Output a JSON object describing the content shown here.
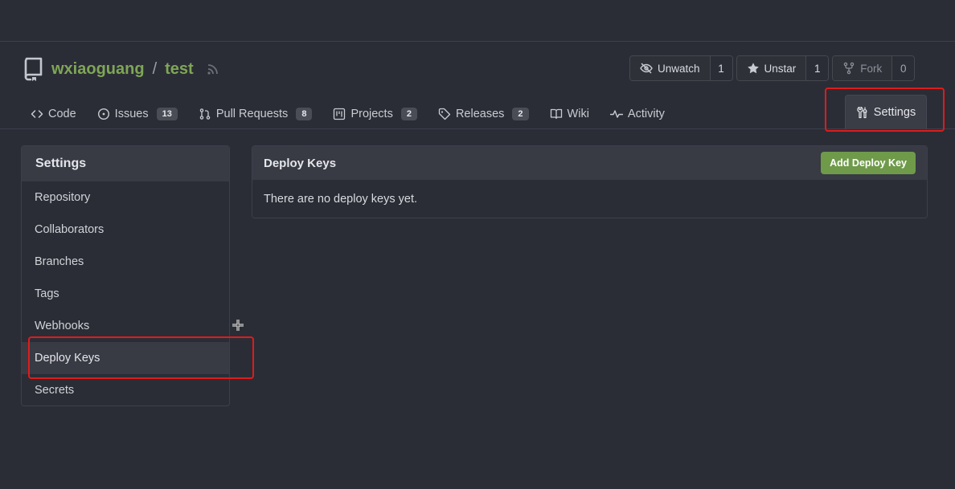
{
  "repo": {
    "owner": "wxiaoguang",
    "separator": "/",
    "name": "test"
  },
  "buttons": {
    "watch": {
      "label": "Unwatch",
      "count": "1"
    },
    "star": {
      "label": "Unstar",
      "count": "1"
    },
    "fork": {
      "label": "Fork",
      "count": "0"
    }
  },
  "tabs": [
    {
      "label": "Code",
      "icon": "code-icon"
    },
    {
      "label": "Issues",
      "icon": "issue-icon",
      "count": "13"
    },
    {
      "label": "Pull Requests",
      "icon": "pull-request-icon",
      "count": "8"
    },
    {
      "label": "Projects",
      "icon": "project-icon",
      "count": "2"
    },
    {
      "label": "Releases",
      "icon": "tag-icon",
      "count": "2"
    },
    {
      "label": "Wiki",
      "icon": "book-icon"
    },
    {
      "label": "Activity",
      "icon": "pulse-icon"
    }
  ],
  "settings_tab": {
    "label": "Settings",
    "icon": "tools-icon"
  },
  "sidebar": {
    "title": "Settings",
    "items": [
      {
        "label": "Repository"
      },
      {
        "label": "Collaborators"
      },
      {
        "label": "Branches"
      },
      {
        "label": "Tags"
      },
      {
        "label": "Webhooks"
      },
      {
        "label": "Deploy Keys",
        "active": true
      },
      {
        "label": "Secrets"
      }
    ]
  },
  "panel": {
    "title": "Deploy Keys",
    "add_button": "Add Deploy Key",
    "empty_text": "There are no deploy keys yet."
  },
  "colors": {
    "accent_green": "#7fa657",
    "button_green": "#6f9a4a",
    "highlight_red": "#e01b1b",
    "background": "#2b2d36"
  }
}
